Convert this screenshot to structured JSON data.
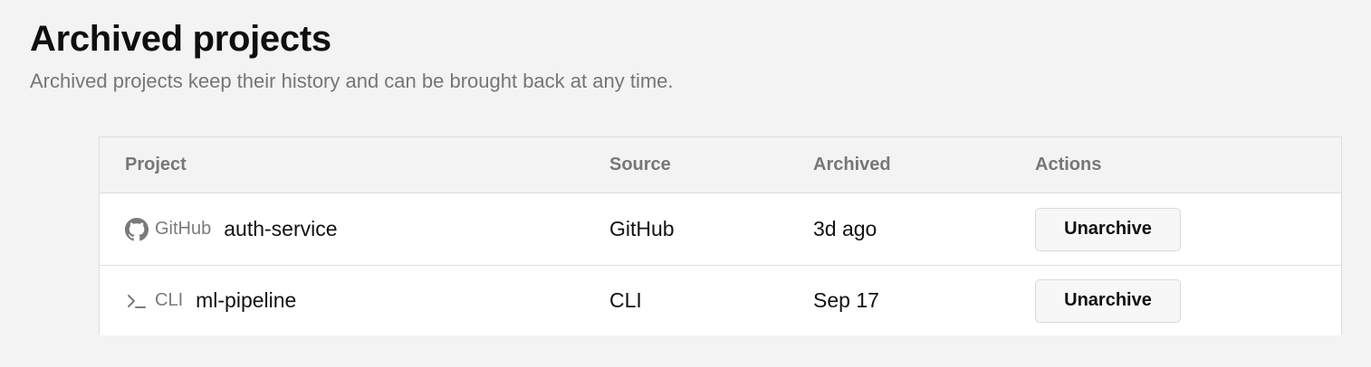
{
  "page": {
    "title": "Archived projects",
    "subtitle": "Archived projects keep their history and can be brought back at any time."
  },
  "table": {
    "columns": [
      "Project",
      "Source",
      "Archived",
      "Actions"
    ],
    "rows": [
      {
        "source_chip_label": "GitHub",
        "source_icon": "github-icon",
        "name": "auth-service",
        "source": "GitHub",
        "archived": "3d ago",
        "action_label": "Unarchive"
      },
      {
        "source_chip_label": "CLI",
        "source_icon": "terminal-icon",
        "name": "ml-pipeline",
        "source": "CLI",
        "archived": "Sep 17",
        "action_label": "Unarchive"
      }
    ]
  }
}
